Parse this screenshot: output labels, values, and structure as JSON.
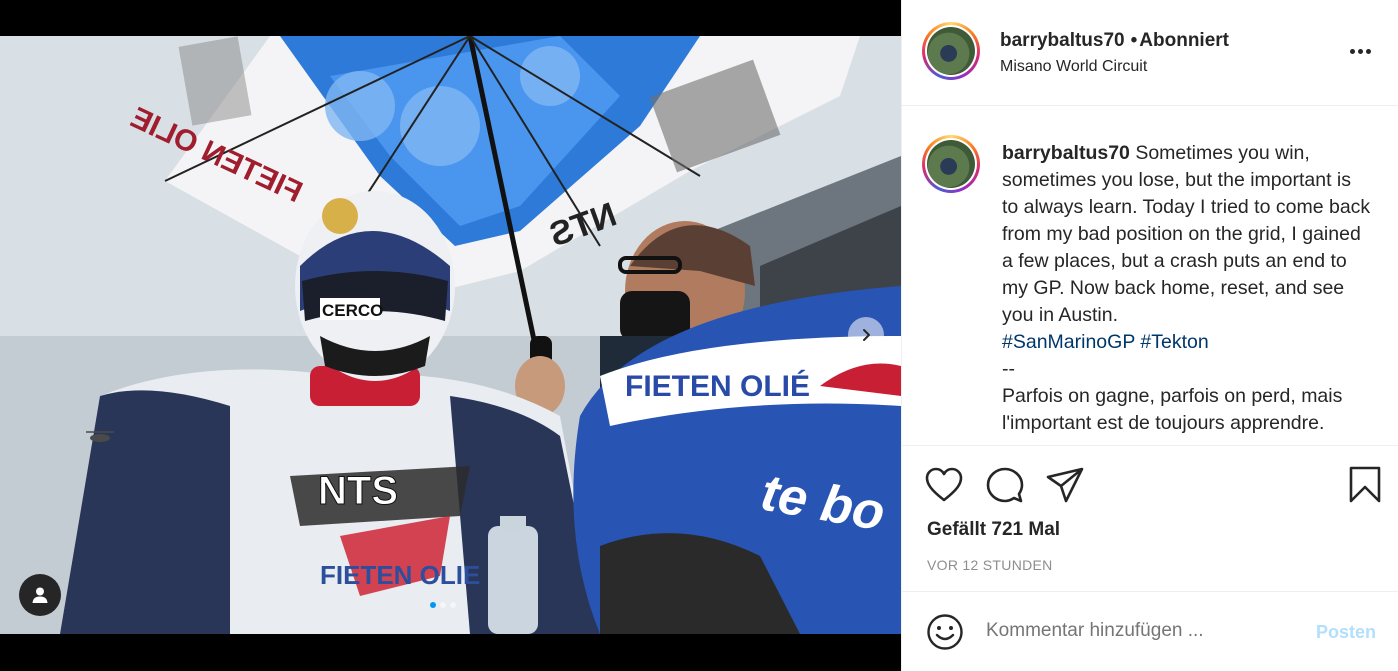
{
  "post": {
    "username": "barrybaltus70",
    "follow_status": "Abonniert",
    "location": "Misano World Circuit",
    "caption": {
      "username": "barrybaltus70",
      "text_en": "Sometimes you win, sometimes you lose, but the important is to always learn. Today I tried to come back from my bad position on the grid, I gained a few places, but a crash puts an end to my GP. Now back home, reset, and see you in Austin.",
      "hashtag_1": "#SanMarinoGP",
      "hashtag_2": "#Tekton",
      "separator": "--",
      "text_fr": "Parfois on gagne, parfois on perd, mais l'important est de toujours apprendre."
    },
    "likes": "Gefällt 721 Mal",
    "time": "VOR 12 STUNDEN",
    "comment_placeholder": "Kommentar hinzufügen ...",
    "post_label": "Posten"
  },
  "media": {
    "photo_texts": {
      "umbrella_brand": "NTS",
      "umbrella_sponsor": "FIETEN OLIE",
      "fairing_sponsor": "FIETEN OLIÉ",
      "fairing_brand": "te bo",
      "helmet_brand": "CERCO",
      "suit_sponsor": "FIETEN OLIE",
      "suit_brand": "NTS"
    },
    "carousel": {
      "current": 1,
      "total": 3
    }
  },
  "icons": {
    "like": "heart-icon",
    "comment": "comment-icon",
    "share": "paper-plane-icon",
    "save": "bookmark-icon",
    "emoji": "smiley-icon",
    "more": "ellipsis-icon",
    "next": "chevron-right-icon",
    "tags": "user-tag-icon"
  },
  "colors": {
    "accent": "#0095f6",
    "post_disabled": "#b2dffc",
    "hashtag": "#00376b",
    "muted": "#8e8e8e"
  }
}
